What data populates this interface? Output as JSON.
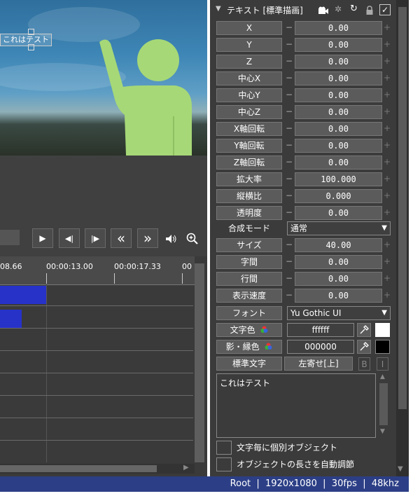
{
  "preview": {
    "overlay_text": "これはテスト"
  },
  "controls": {
    "play": "▶",
    "prev_frame": "◀|",
    "next_frame": "|▶",
    "rewind": "«",
    "forward": "»",
    "volume": "🔊",
    "zoom": "🔍"
  },
  "timeline": {
    "ticks": [
      "08.66",
      "00:00:13.00",
      "00:00:17.33",
      "00"
    ]
  },
  "object_panel": {
    "title": "テキスト [標準描画]",
    "params": [
      {
        "label": "X",
        "value": "0.00"
      },
      {
        "label": "Y",
        "value": "0.00"
      },
      {
        "label": "Z",
        "value": "0.00"
      },
      {
        "label": "中心X",
        "value": "0.00"
      },
      {
        "label": "中心Y",
        "value": "0.00"
      },
      {
        "label": "中心Z",
        "value": "0.00"
      },
      {
        "label": "X軸回転",
        "value": "0.00"
      },
      {
        "label": "Y軸回転",
        "value": "0.00"
      },
      {
        "label": "Z軸回転",
        "value": "0.00"
      },
      {
        "label": "拡大率",
        "value": "100.000"
      },
      {
        "label": "縦横比",
        "value": "0.000"
      },
      {
        "label": "透明度",
        "value": "0.00"
      }
    ],
    "blend_label": "合成モード",
    "blend_value": "通常",
    "params2": [
      {
        "label": "サイズ",
        "value": "40.00"
      },
      {
        "label": "字間",
        "value": "0.00"
      },
      {
        "label": "行間",
        "value": "0.00"
      },
      {
        "label": "表示速度",
        "value": "0.00"
      }
    ],
    "font_label": "フォント",
    "font_value": "Yu Gothic UI",
    "text_color_label": "文字色",
    "text_color_value": "ffffff",
    "shadow_color_label": "影・縁色",
    "shadow_color_value": "000000",
    "style_button": "標準文字",
    "align_button": "左寄せ[上]",
    "bold": "B",
    "italic": "I",
    "text_content": "これはテスト",
    "check1": "文字毎に個別オブジェクト",
    "check2": "オブジェクトの長さを自動調節"
  },
  "status": {
    "text": "Root  |  1920x1080  |  30fps  |  48khz"
  },
  "colors": {
    "clip": "#2732c9",
    "status_bar": "#2c3f86",
    "figure": "#a6d877"
  }
}
